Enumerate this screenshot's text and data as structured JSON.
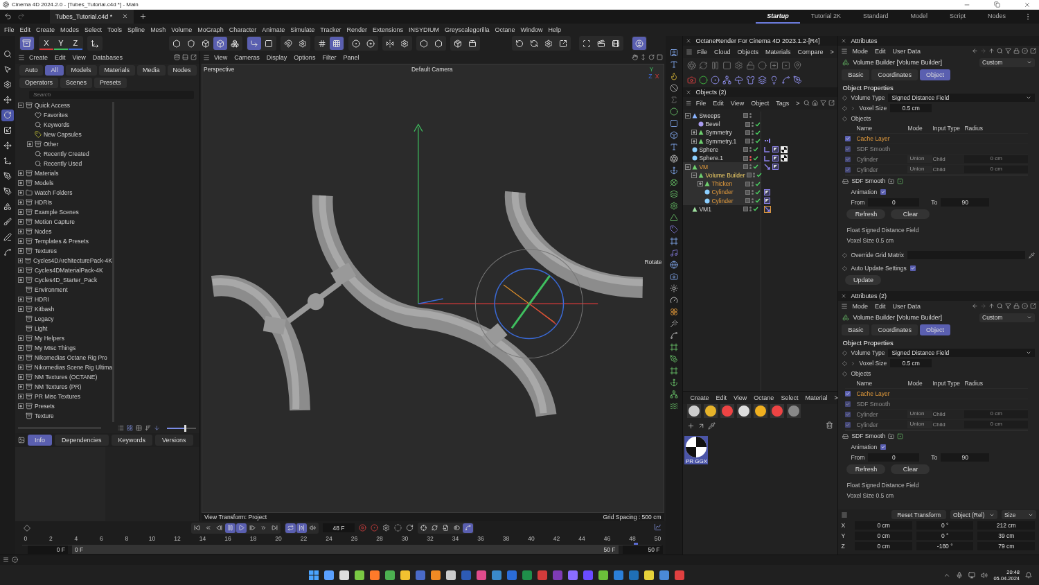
{
  "title_bar": {
    "title": "Cinema 4D 2024.2.0 - [Tubes_Tutorial.c4d *] - Main"
  },
  "doc_tabs": [
    {
      "label": "Tubes_Tutorial.c4d *",
      "selected": true
    }
  ],
  "layouts": [
    {
      "label": "Startup",
      "selected": true
    },
    {
      "label": "Tutorial 2K",
      "selected": false
    },
    {
      "label": "Standard",
      "selected": false
    },
    {
      "label": "Model",
      "selected": false
    },
    {
      "label": "Script",
      "selected": false
    },
    {
      "label": "Nodes",
      "selected": false
    }
  ],
  "menu": [
    "File",
    "Edit",
    "Create",
    "Modes",
    "Select",
    "Tools",
    "Spline",
    "Mesh",
    "Volume",
    "MoGraph",
    "Character",
    "Animate",
    "Simulate",
    "Tracker",
    "Render",
    "Extensions",
    "INSYDIUM",
    "Greyscalegorilla",
    "Octane",
    "Window",
    "Help"
  ],
  "toolbar": {
    "mode": {
      "on": true
    },
    "axes": [
      {
        "label": "X",
        "on": false
      },
      {
        "label": "Y",
        "on": false
      },
      {
        "label": "Z",
        "on": false
      }
    ],
    "groups": [
      [
        {
          "on": false
        }
      ],
      [
        {
          "on": false
        },
        {
          "on": false
        },
        {
          "on": false
        },
        {
          "on": true
        },
        {
          "on": false
        }
      ],
      [
        {
          "on": true
        },
        {
          "on": false
        }
      ],
      [
        {
          "on": false
        },
        {
          "on": false
        }
      ],
      [
        {
          "on": false
        },
        {
          "on": true
        }
      ],
      [
        {
          "on": false
        },
        {
          "on": false
        }
      ],
      [
        {
          "on": false
        },
        {
          "on": false
        }
      ],
      [
        {
          "on": false
        },
        {
          "on": false
        }
      ],
      [
        {
          "on": false
        },
        {
          "on": false
        }
      ]
    ],
    "right_groups": [
      [
        {
          "on": false
        },
        {
          "on": false
        },
        {
          "on": false
        },
        {
          "on": false
        }
      ],
      [
        {
          "on": false
        },
        {
          "on": false
        },
        {
          "on": false
        }
      ],
      [
        {
          "on": true
        }
      ]
    ]
  },
  "left_tools": [
    {
      "on": false
    },
    {
      "on": false
    },
    {
      "on": false
    },
    {
      "on": false
    },
    {
      "on": true
    },
    {
      "on": false
    },
    {
      "on": false
    },
    {
      "on": false
    },
    {
      "on": false
    },
    {
      "on": false
    },
    {
      "on": false
    },
    {
      "on": false
    },
    {
      "on": false
    },
    {
      "on": false
    }
  ],
  "asset_browser": {
    "menu": [
      "Create",
      "Edit",
      "View",
      "Databases"
    ],
    "filters": [
      [
        {
          "label": "Auto",
          "selected": false
        },
        {
          "label": "All",
          "selected": true
        },
        {
          "label": "Models",
          "selected": false
        },
        {
          "label": "Materials",
          "selected": false
        },
        {
          "label": "Media",
          "selected": false
        },
        {
          "label": "Nodes",
          "selected": false
        }
      ],
      [
        {
          "label": "Operators",
          "selected": false
        },
        {
          "label": "Scenes",
          "selected": false
        },
        {
          "label": "Presets",
          "selected": false
        }
      ]
    ],
    "search": {
      "placeholder": "Search"
    },
    "tree": [
      {
        "label": "Quick Access",
        "kind": "capsule",
        "expanded": true,
        "children": [
          {
            "label": "Favorites",
            "kind": "heart"
          },
          {
            "label": "Keywords",
            "kind": "search"
          },
          {
            "label": "New Capsules",
            "kind": "tag"
          },
          {
            "label": "Other",
            "kind": "capsule",
            "expanded": false
          },
          {
            "label": "Recently Created",
            "kind": "search"
          },
          {
            "label": "Recently Used",
            "kind": "search"
          }
        ]
      },
      {
        "label": "Materials",
        "kind": "capsule",
        "expanded": false
      },
      {
        "label": "Models",
        "kind": "capsule",
        "expanded": false
      },
      {
        "label": "Watch Folders",
        "kind": "folder",
        "expanded": false
      },
      {
        "label": "HDRIs",
        "kind": "capsule",
        "expanded": false
      },
      {
        "label": "Example Scenes",
        "kind": "capsule",
        "expanded": false
      },
      {
        "label": "Motion Capture",
        "kind": "capsule",
        "expanded": false
      },
      {
        "label": "Nodes",
        "kind": "capsule",
        "expanded": false
      },
      {
        "label": "Templates & Presets",
        "kind": "capsule",
        "expanded": false
      },
      {
        "label": "Textures",
        "kind": "capsule",
        "expanded": false
      },
      {
        "label": "Cycles4DArchitecturePack-4K",
        "kind": "capsule",
        "expanded": false
      },
      {
        "label": "Cycles4DMaterialPack-4K",
        "kind": "capsule",
        "expanded": false
      },
      {
        "label": "Cycles4D_Starter_Pack",
        "kind": "capsule",
        "expanded": false
      },
      {
        "label": "Environment",
        "kind": "capsule"
      },
      {
        "label": "HDRI",
        "kind": "capsule",
        "expanded": false
      },
      {
        "label": "Kitbash",
        "kind": "capsule",
        "expanded": false
      },
      {
        "label": "Legacy",
        "kind": "capsule"
      },
      {
        "label": "Light",
        "kind": "capsule"
      },
      {
        "label": "My Helpers",
        "kind": "capsule",
        "expanded": false
      },
      {
        "label": "My MIsc Things",
        "kind": "capsule",
        "expanded": false
      },
      {
        "label": "Nikomedias Octane Rig Pro",
        "kind": "capsule",
        "expanded": false
      },
      {
        "label": "Nikomedias Scene Rig Ultima",
        "kind": "capsule",
        "expanded": false
      },
      {
        "label": "NM Textures (OCTANE)",
        "kind": "capsule",
        "expanded": false
      },
      {
        "label": "NM Textures (PR)",
        "kind": "capsule",
        "expanded": false
      },
      {
        "label": "PR Misc Textures",
        "kind": "capsule",
        "expanded": false
      },
      {
        "label": "Presets",
        "kind": "capsule",
        "expanded": false
      },
      {
        "label": "Texture",
        "kind": "capsule"
      }
    ],
    "thumbnail_size": {
      "level": 0.6
    },
    "info_tabs": [
      {
        "label": "Info",
        "selected": true
      },
      {
        "label": "Dependencies",
        "selected": false
      },
      {
        "label": "Keywords",
        "selected": false
      },
      {
        "label": "Versions",
        "selected": false
      }
    ]
  },
  "viewport": {
    "menu": [
      "View",
      "Cameras",
      "Display",
      "Options",
      "Filter",
      "Panel"
    ],
    "camera_name": "Perspective",
    "camera": "Default Camera",
    "axis_labels": [
      "Y",
      "Z",
      "X"
    ],
    "tool_hint": "Rotate",
    "view_transform": "View Transform: Project",
    "grid_spacing": "Grid Spacing : 500 cm"
  },
  "timeline": {
    "transport": [
      [
        {
          "on": false
        },
        {
          "on": false
        },
        {
          "on": false
        },
        {
          "on": true
        },
        {
          "on": true
        },
        {
          "on": false
        },
        {
          "on": false
        },
        {
          "on": false
        }
      ],
      [
        {
          "on": true
        },
        {
          "on": true
        },
        {
          "on": false
        }
      ]
    ],
    "current_frame": "48 F",
    "keys": [
      {
        "on": false
      },
      {
        "on": false
      },
      {
        "on": false
      },
      {
        "on": false
      },
      {
        "on": true
      }
    ],
    "ticks": [
      "0",
      "2",
      "4",
      "6",
      "8",
      "10",
      "12",
      "14",
      "16",
      "18",
      "20",
      "22",
      "24",
      "26",
      "28",
      "30",
      "32",
      "34",
      "36",
      "38",
      "40",
      "42",
      "44",
      "46",
      "48",
      "50"
    ],
    "playhead": {
      "level": 0.96
    },
    "start": "0 F",
    "min": "0 F",
    "max": "50 F",
    "end": "50 F"
  },
  "octane": {
    "title": "OctaneRender For Cinema 4D 2023.1.2-[R4]",
    "menu": [
      "File",
      "Cloud",
      "Objects",
      "Materials",
      "Compare",
      ">"
    ]
  },
  "objects": {
    "title": "Objects (2)",
    "menu": [
      "File",
      "Edit",
      "View",
      "Object",
      "Tags",
      ">"
    ],
    "tree": [
      {
        "name": "Sweeps",
        "kind": "sweep",
        "expanded": true,
        "selected": false,
        "active": false,
        "visible": true,
        "enabled": false,
        "children": [
          {
            "name": "Bevel",
            "kind": "bevel",
            "selected": false,
            "active": false,
            "visible": true,
            "enabled": true
          },
          {
            "name": "Symmetry",
            "kind": "symmetry",
            "expanded": false,
            "selected": false,
            "active": false,
            "visible": true,
            "enabled": true
          },
          {
            "name": "Symmetry.1",
            "kind": "symmetry",
            "expanded": false,
            "selected": false,
            "active": false,
            "visible": true,
            "enabled": true,
            "tags": [
              {
                "kind": "selection"
              }
            ]
          }
        ]
      },
      {
        "name": "Sphere",
        "kind": "sphere",
        "selected": false,
        "active": false,
        "visible": true,
        "enabled": true,
        "tags": [
          {
            "kind": "phong"
          },
          {
            "kind": "texture"
          },
          {
            "kind": "material"
          }
        ]
      },
      {
        "name": "Sphere.1",
        "kind": "sphere",
        "selected": false,
        "active": false,
        "visible": false,
        "enabled": true,
        "tags": [
          {
            "kind": "phong"
          },
          {
            "kind": "texture"
          },
          {
            "kind": "material"
          }
        ]
      },
      {
        "name": "VM",
        "kind": "mesher",
        "expanded": true,
        "selected": true,
        "active": false,
        "visible": true,
        "enabled": true,
        "tags": [
          {
            "kind": "target"
          },
          {
            "kind": "texture"
          }
        ],
        "children": [
          {
            "name": "Volume Builder",
            "kind": "builder",
            "expanded": true,
            "selected": true,
            "active": true,
            "visible": true,
            "enabled": true,
            "children": [
              {
                "name": "Thicken",
                "kind": "thicken",
                "expanded": false,
                "selected": true,
                "active": false,
                "visible": true,
                "enabled": true
              },
              {
                "name": "Cylinder",
                "kind": "cylinder",
                "selected": true,
                "active": false,
                "visible": true,
                "enabled": true,
                "tags": [
                  {
                    "kind": "texture"
                  }
                ]
              },
              {
                "name": "Cylinder",
                "kind": "cylinder",
                "selected": true,
                "active": false,
                "visible": true,
                "enabled": true,
                "tags": [
                  {
                    "kind": "texture"
                  }
                ]
              }
            ]
          }
        ]
      },
      {
        "name": "VM1",
        "kind": "mesh",
        "selected": false,
        "active": false,
        "visible": true,
        "enabled": true,
        "tags": [
          {
            "kind": "target-active"
          }
        ]
      }
    ]
  },
  "materials": {
    "menu": [
      "Create",
      "Edit",
      "View",
      "Octane",
      "Select",
      "Material",
      ">"
    ],
    "items": [
      {
        "label": "PR GGX",
        "selected": true
      }
    ]
  },
  "attribute_panels": [
    {
      "title": "Attributes",
      "menu": [
        "Mode",
        "Edit",
        "User Data"
      ],
      "object": "Volume Builder [Volume Builder]",
      "preset": "Custom",
      "tabs": [
        {
          "label": "Basic",
          "selected": false
        },
        {
          "label": "Coordinates",
          "selected": false
        },
        {
          "label": "Object",
          "selected": true
        }
      ],
      "section": "Object Properties",
      "volume_type_label": "Volume Type",
      "volume_type": "Signed Distance Field",
      "voxel_label": "Voxel Size",
      "voxel_size": "0.5 cm",
      "objects_label": "Objects",
      "columns": [
        "Name",
        "Mode",
        "Input Type",
        "Radius"
      ],
      "rows": [
        {
          "name": "Cache Layer",
          "checked": true,
          "enabled": true
        },
        {
          "name": "SDF Smooth",
          "checked": true,
          "enabled": false
        },
        {
          "name": "Cylinder",
          "mode": "Union",
          "input_type": "Child",
          "radius": "0 cm",
          "checked": true,
          "enabled": false
        },
        {
          "name": "Cylinder",
          "mode": "Union",
          "input_type": "Child",
          "radius": "0 cm",
          "checked": true,
          "enabled": false
        }
      ],
      "layer": "SDF Smooth",
      "animation_label": "Animation",
      "animation": true,
      "from_label": "From",
      "from": "0",
      "to_label": "To",
      "to": "90",
      "buttons": [
        "Refresh",
        "Clear"
      ],
      "info": [
        "Float Signed Distance Field",
        "Voxel Size 0.5 cm"
      ],
      "override_label": "Override Grid Matrix",
      "auto_update": {
        "label": "Auto Update Settings",
        "checked": true
      },
      "update_button": "Update"
    },
    {
      "title": "Attributes (2)",
      "menu": [
        "Mode",
        "Edit",
        "User Data"
      ],
      "object": "Volume Builder [Volume Builder]",
      "preset": "Custom",
      "tabs": [
        {
          "label": "Basic",
          "selected": false
        },
        {
          "label": "Coordinates",
          "selected": false
        },
        {
          "label": "Object",
          "selected": true
        }
      ],
      "section": "Object Properties",
      "volume_type_label": "Volume Type",
      "volume_type": "Signed Distance Field",
      "voxel_label": "Voxel Size",
      "voxel_size": "0.5 cm",
      "objects_label": "Objects",
      "columns": [
        "Name",
        "Mode",
        "Input Type",
        "Radius"
      ],
      "rows": [
        {
          "name": "Cache Layer",
          "checked": true,
          "enabled": true
        },
        {
          "name": "SDF Smooth",
          "checked": true,
          "enabled": false
        },
        {
          "name": "Cylinder",
          "mode": "Union",
          "input_type": "Child",
          "radius": "0 cm",
          "checked": true,
          "enabled": false
        },
        {
          "name": "Cylinder",
          "mode": "Union",
          "input_type": "Child",
          "radius": "0 cm",
          "checked": true,
          "enabled": false
        }
      ],
      "layer": "SDF Smooth",
      "animation_label": "Animation",
      "animation": true,
      "from_label": "From",
      "from": "0",
      "to_label": "To",
      "to": "90",
      "buttons": [
        "Refresh",
        "Clear"
      ],
      "info": [
        "Float Signed Distance Field",
        "Voxel Size 0.5 cm"
      ]
    }
  ],
  "coordinates": {
    "reset_button": "Reset Transform",
    "mode": "Object (Rel)",
    "size_mode": "Size",
    "rows": [
      {
        "axis": "X",
        "position": "0 cm",
        "rotation": "0 °",
        "size": "212 cm"
      },
      {
        "axis": "Y",
        "position": "0 cm",
        "rotation": "0 °",
        "size": "39 cm"
      },
      {
        "axis": "Z",
        "position": "0 cm",
        "rotation": "-180 °",
        "size": "79 cm"
      }
    ]
  },
  "taskbar": {
    "time": "20:48",
    "date": "05.04.2024"
  }
}
